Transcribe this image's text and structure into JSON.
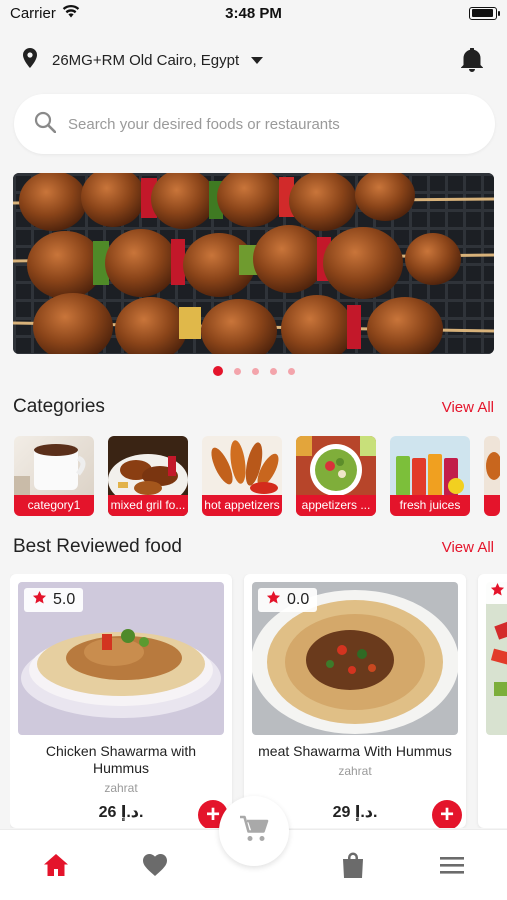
{
  "status_bar": {
    "carrier": "Carrier",
    "time": "3:48 PM",
    "battery_level": 0.95
  },
  "location": {
    "text": "26MG+RM Old Cairo, Egypt",
    "icon": "location-pin-icon"
  },
  "search": {
    "placeholder": "Search your desired foods or restaurants",
    "value": ""
  },
  "banner": {
    "slides_count": 5,
    "active_index": 0
  },
  "categories": {
    "title": "Categories",
    "view_all": "View All",
    "items": [
      {
        "label": "category1"
      },
      {
        "label": "mixed gril fo..."
      },
      {
        "label": "hot appetizers"
      },
      {
        "label": "appetizers ..."
      },
      {
        "label": "fresh juices"
      }
    ]
  },
  "best_reviewed": {
    "title": "Best Reviewed food",
    "view_all": "View All",
    "items": [
      {
        "name": "Chicken Shawarma with Hummus",
        "restaurant": "zahrat",
        "rating": "5.0",
        "price": "26 د.إ."
      },
      {
        "name": "meat Shawarma With Hummus",
        "restaurant": "zahrat",
        "rating": "0.0",
        "price": "29 د.إ."
      }
    ]
  },
  "bottom_nav": {
    "items": [
      "home-icon",
      "heart-icon",
      "cart-icon",
      "bag-icon",
      "menu-icon"
    ],
    "active": "home-icon"
  },
  "colors": {
    "accent": "#e4142b",
    "background": "#f5f5f5",
    "inactive_icon": "#6b6b6b"
  }
}
